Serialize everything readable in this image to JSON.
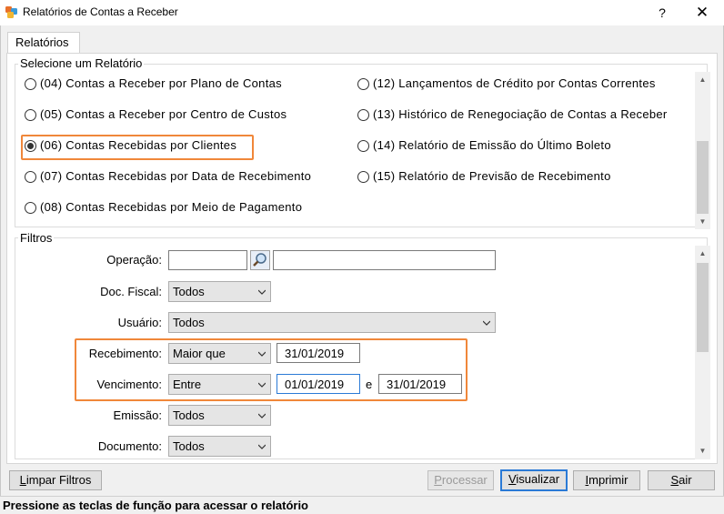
{
  "window": {
    "title": "Relatórios de Contas a Receber",
    "help": "?",
    "close": "✕"
  },
  "tab": {
    "label": "Relatórios"
  },
  "report_group": {
    "legend": "Selecione um Relatório",
    "items": [
      {
        "label": "(04) Contas a Receber por Plano de Contas",
        "selected": false
      },
      {
        "label": "(05) Contas a Receber por Centro de Custos",
        "selected": false
      },
      {
        "label": "(06) Contas Recebidas por Clientes",
        "selected": true
      },
      {
        "label": "(07) Contas Recebidas por Data de Recebimento",
        "selected": false
      },
      {
        "label": "(08) Contas Recebidas por Meio de Pagamento",
        "selected": false
      },
      {
        "label": "(12) Lançamentos de Crédito por Contas Correntes",
        "selected": false
      },
      {
        "label": "(13) Histórico de Renegociação de Contas a Receber",
        "selected": false
      },
      {
        "label": "(14) Relatório de Emissão do Último Boleto",
        "selected": false
      },
      {
        "label": "(15) Relatório de Previsão de Recebimento",
        "selected": false
      }
    ]
  },
  "filters": {
    "legend": "Filtros",
    "operacao": {
      "label": "Operação:",
      "code": "",
      "description": ""
    },
    "doc_fiscal": {
      "label": "Doc. Fiscal:",
      "value": "Todos"
    },
    "usuario": {
      "label": "Usuário:",
      "value": "Todos"
    },
    "recebimento": {
      "label": "Recebimento:",
      "operator": "Maior que",
      "date": "31/01/2019"
    },
    "vencimento": {
      "label": "Vencimento:",
      "operator": "Entre",
      "date_from": "01/01/2019",
      "connector": "e",
      "date_to": "31/01/2019"
    },
    "emissao": {
      "label": "Emissão:",
      "value": "Todos"
    },
    "documento": {
      "label": "Documento:",
      "value": "Todos"
    }
  },
  "buttons": {
    "limpar_key": "L",
    "limpar_rest": "impar Filtros",
    "processar_key": "P",
    "processar_rest": "rocessar",
    "visualizar_key": "V",
    "visualizar_rest": "isualizar",
    "imprimir_key": "I",
    "imprimir_rest": "mprimir",
    "sair_key": "S",
    "sair_rest": "air"
  },
  "status": {
    "text": "Pressione as teclas de função para acessar o relatório"
  },
  "colors": {
    "highlight": "#f0873a",
    "default_button": "#2a7ad6"
  }
}
